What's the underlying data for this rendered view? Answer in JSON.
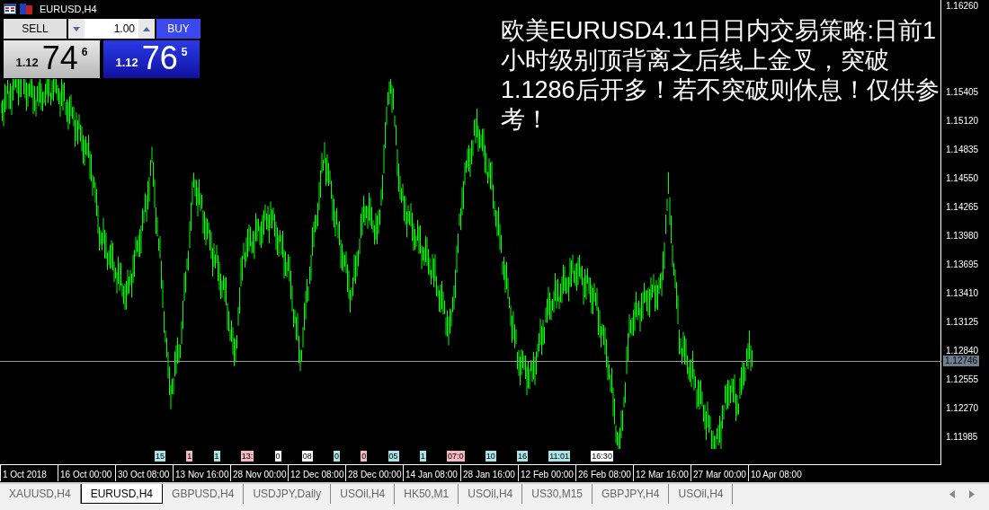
{
  "window": {
    "title": "EURUSD,H4"
  },
  "trade_panel": {
    "sell_label": "SELL",
    "lot": "1.00",
    "buy_label": "BUY",
    "sell_price": {
      "big_figure": "1.12",
      "pips": "74",
      "fraction": "6"
    },
    "buy_price": {
      "big_figure": "1.12",
      "pips": "76",
      "fraction": "5"
    }
  },
  "annotation": "欧美EURUSD4.11日日内交易策略:日前1小时级别顶背离之后线上金叉，突破1.1286后开多！若不突破则休息！仅供参考！",
  "price_axis": {
    "ticks": [
      "1.16260",
      "1.15405",
      "1.15120",
      "1.14835",
      "1.14550",
      "1.14265",
      "1.13980",
      "1.13695",
      "1.13410",
      "1.13125",
      "1.12840",
      "1.12555",
      "1.12270",
      "1.11985"
    ],
    "current_price": "1.12746"
  },
  "time_axis": [
    "1 Oct 2018",
    "16 Oct 00:00",
    "30 Oct 08:00",
    "13 Nov 16:00",
    "28 Nov 00:00",
    "12 Dec 08:00",
    "28 Dec 00:00",
    "14 Jan 08:00",
    "28 Jan 16:00",
    "12 Feb 00:00",
    "26 Feb 08:00",
    "12 Mar 16:00",
    "27 Mar 00:00",
    "10 Apr 08:00"
  ],
  "events": [
    {
      "text": "15",
      "color": "#a8e4e8"
    },
    {
      "text": "1",
      "color": "#f4b8c0"
    },
    {
      "text": "1",
      "color": "#a8e4e8"
    },
    {
      "text": "13:",
      "color": "#f4b8c0"
    },
    {
      "text": "0",
      "color": "#ffffff"
    },
    {
      "text": "08",
      "color": "#ffffff"
    },
    {
      "text": "0",
      "color": "#a8e4e8"
    },
    {
      "text": "0",
      "color": "#f4b8c0"
    },
    {
      "text": "05",
      "color": "#a8e4e8"
    },
    {
      "text": "1",
      "color": "#a8e4e8"
    },
    {
      "text": "07:0",
      "color": "#f4b8c0"
    },
    {
      "text": "10",
      "color": "#a8e4e8"
    },
    {
      "text": "16",
      "color": "#a8e4e8"
    },
    {
      "text": "11:01",
      "color": "#a8e4e8"
    },
    {
      "text": "16:30",
      "color": "#ffffff"
    }
  ],
  "tabs": [
    {
      "label": "XAUUSD,H4",
      "selected": false
    },
    {
      "label": "EURUSD,H4",
      "selected": true
    },
    {
      "label": "GBPUSD,H4",
      "selected": false
    },
    {
      "label": "USDJPY,Daily",
      "selected": false
    },
    {
      "label": "USOil,H4",
      "selected": false
    },
    {
      "label": "HK50,M1",
      "selected": false
    },
    {
      "label": "USOil,H4",
      "selected": false
    },
    {
      "label": "US30,M15",
      "selected": false
    },
    {
      "label": "GBPJPY,H4",
      "selected": false
    },
    {
      "label": "USOil,H4",
      "selected": false
    }
  ]
}
